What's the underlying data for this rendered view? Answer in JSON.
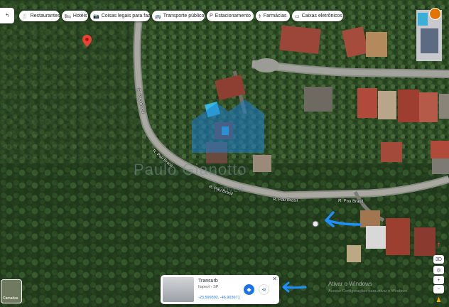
{
  "toolbar": {
    "chips": [
      {
        "icon": "restaurant-icon",
        "glyph": "🍴",
        "label": "Restaurantes"
      },
      {
        "icon": "hotel-icon",
        "glyph": "🛏",
        "label": "Hotéis"
      },
      {
        "icon": "camera-icon",
        "glyph": "📷",
        "label": "Coisas legais para faz..."
      },
      {
        "icon": "transit-icon",
        "glyph": "🚌",
        "label": "Transporte público"
      },
      {
        "icon": "parking-icon",
        "glyph": "P",
        "label": "Estacionamento"
      },
      {
        "icon": "pharmacy-icon",
        "glyph": "⚕",
        "label": "Farmácias"
      },
      {
        "icon": "atm-icon",
        "glyph": "▭",
        "label": "Caixas eletrônicos"
      }
    ]
  },
  "roads": {
    "label_1": "R. Pau Brasil",
    "label_2": "R. Pau Brasil",
    "label_3": "R. Pau Brasil",
    "label_4": "R. Pau Brasil",
    "label_5": "R. Pau Brasil"
  },
  "watermark": {
    "brand_line1": "Paulo Gianotto",
    "brand_line2": "Imóveis",
    "activate_title": "Ativar o Windows",
    "activate_sub": "Acesse Configurações para ativar o Windows."
  },
  "place_card": {
    "title": "Transurb",
    "subtitle": "Itapevi - SP",
    "coordinates": "-23.599392, -46.903671"
  },
  "map_controls": {
    "three_d": "3D",
    "zoom_in": "+",
    "zoom_out": "−"
  },
  "layers": {
    "label": "Camadas"
  },
  "colors": {
    "accent": "#1a73e8",
    "pin": "#ea4335",
    "arrow": "#1e90ff"
  }
}
